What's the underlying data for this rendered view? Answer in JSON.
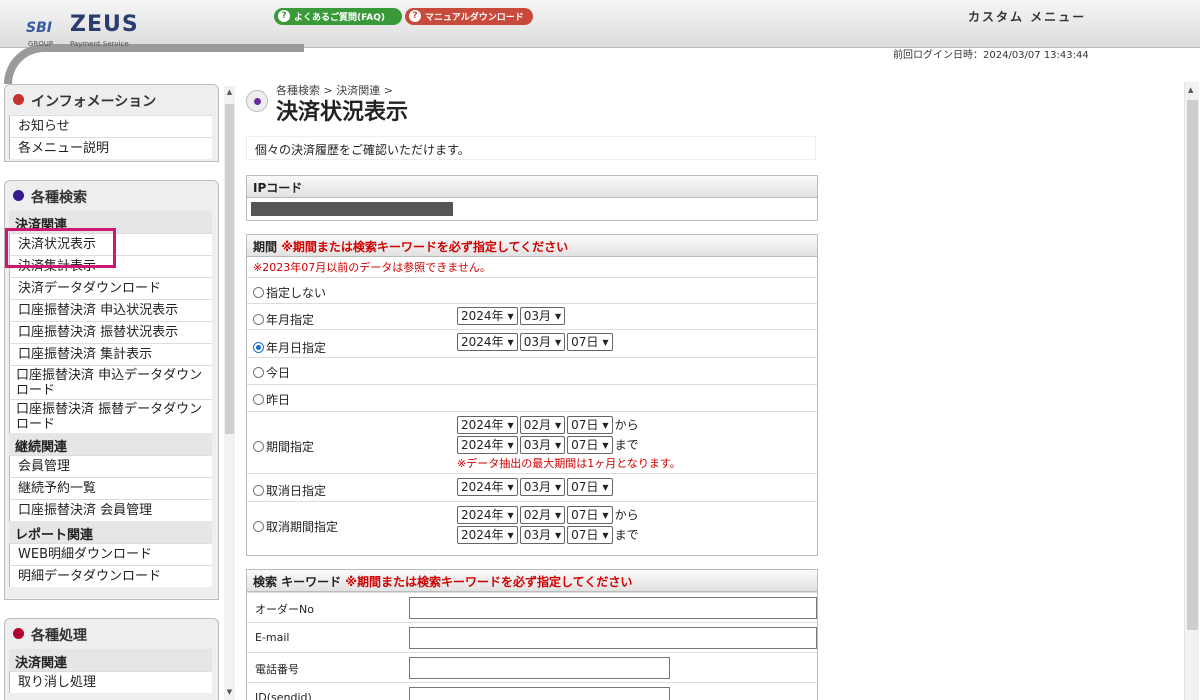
{
  "header": {
    "logo_sbi": "SBI",
    "logo_zeus": "ZEUS",
    "logo_group": "GROUP",
    "logo_payment": "Payment Service",
    "faq_label": "よくあるご質問(FAQ)",
    "manual_label": "マニュアルダウンロード",
    "custom_menu": "カスタム メニュー",
    "last_login": "前回ログイン日時：2024/03/07 13:43:44"
  },
  "sidebar": {
    "info_title": "インフォメーション",
    "info_items": [
      "お知らせ",
      "各メニュー説明"
    ],
    "search_title": "各種検索",
    "search_sec1": "決済関連",
    "search_items1": [
      "決済状況表示",
      "決済集計表示",
      "決済データダウンロード",
      "口座振替決済 申込状況表示",
      "口座振替決済 振替状況表示",
      "口座振替決済 集計表示",
      "口座振替決済 申込データダウンロード",
      "口座振替決済 振替データダウンロード"
    ],
    "search_sec2": "継続関連",
    "search_items2": [
      "会員管理",
      "継続予約一覧",
      "口座振替決済 会員管理"
    ],
    "search_sec3": "レポート関連",
    "search_items3": [
      "WEB明細ダウンロード",
      "明細データダウンロード"
    ],
    "proc_title": "各種処理",
    "proc_sec1": "決済関連",
    "proc_items1": [
      "取り消し処理"
    ]
  },
  "main": {
    "breadcrumb": "各種検索 > 決済関連 >",
    "title": "決済状況表示",
    "description": "個々の決済履歴をご確認いただけます。",
    "ip_header": "IPコード",
    "period_header": "期間",
    "period_warning": "※期間または検索キーワードを必ず指定してください",
    "period_note": "※2023年07月以前のデータは参照できません。",
    "opt_none": "指定しない",
    "opt_ym": "年月指定",
    "opt_ymd": "年月日指定",
    "opt_today": "今日",
    "opt_yesterday": "昨日",
    "opt_range": "期間指定",
    "opt_cancel": "取消日指定",
    "opt_cancel_range": "取消期間指定",
    "year": "2024年",
    "month_03": "03月",
    "month_02": "02月",
    "day_07": "07日",
    "from": "から",
    "to": "まで",
    "range_note": "※データ抽出の最大期間は1ヶ月となります。",
    "kw_header": "検索 キーワード",
    "kw_warning": "※期間または検索キーワードを必ず指定してください",
    "kw_labels": [
      "オーダーNo",
      "E-mail",
      "電話番号",
      "ID(sendid)"
    ]
  },
  "colors": {
    "faq": "#3a9a3a",
    "manual": "#c84a3a",
    "highlight": "#d0166e",
    "warning": "#d10000",
    "radio_on": "#1a6ad8"
  }
}
